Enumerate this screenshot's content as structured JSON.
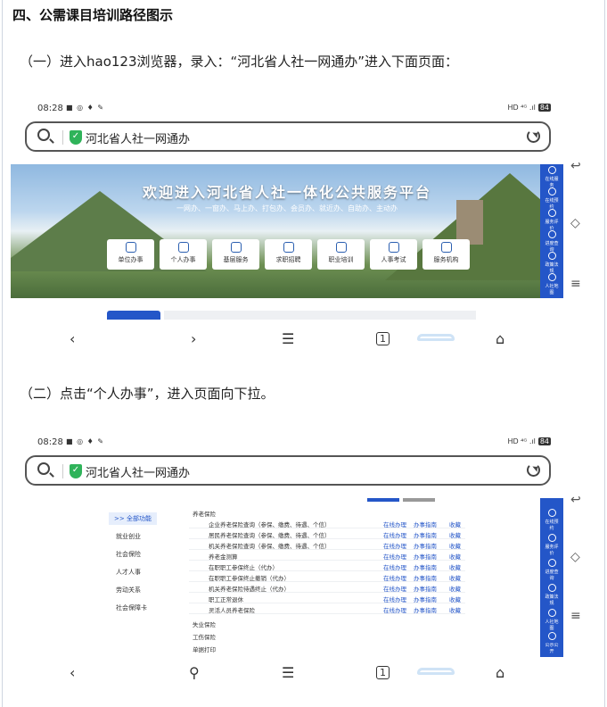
{
  "heading": "四、公需课目培训路径图示",
  "step1": "（一）进入hao123浏览器，录入：“河北省人社一网通办”进入下面页面：",
  "step2": "（二）点击“个人办事”，进入页面向下拉。",
  "status": {
    "time": "08:28",
    "right": "HD ⁴ᴳ .ıl",
    "battery": "84"
  },
  "url_text": "河北省人社一网通办",
  "banner": {
    "title": "欢迎进入河北省人社一体化公共服务平台",
    "slogan": "一网办、一窗办、马上办、打包办、会员办、就近办、自助办、主动办",
    "tiles": [
      "单位办事",
      "个人办事",
      "基层服务",
      "求职招聘",
      "职业培训",
      "人事考试",
      "服务机构"
    ]
  },
  "side_panel": [
    "在线服务",
    "在线预约",
    "服务评价",
    "进度查询",
    "政策法规",
    "人社地图",
    "公示公开"
  ],
  "nav": {
    "back": "‹",
    "forward": "›",
    "menu": "☰",
    "tabs": "1",
    "home": "⌂",
    "search": "⚲"
  },
  "side_nav": {
    "back": "↩",
    "home": "◇",
    "menu": "≡"
  },
  "shot2": {
    "left_menu": [
      ">> 全部功能",
      "就业创业",
      "社会保险",
      "人才人事",
      "劳动关系",
      "社会保障卡"
    ],
    "category_pension": "养老保险",
    "rows": [
      "企业养老保险查询（参保、缴费、待遇、个信）",
      "居民养老保险查询（参保、缴费、待遇、个信）",
      "机关养老保险查询（参保、缴费、待遇、个信）",
      "养老金测算",
      "在职职工参保终止（代办）",
      "在职职工参保终止撤销（代办）",
      "机关养老保险待遇终止（代办）",
      "职工正常退休",
      "灵活人员养老保险"
    ],
    "row_actions": {
      "online": "在线办理",
      "guide": "办事指南",
      "fav": "收藏"
    },
    "category_unemployment": "失业保险",
    "category_injury": "工伤保险",
    "category_print": "单据打印"
  }
}
